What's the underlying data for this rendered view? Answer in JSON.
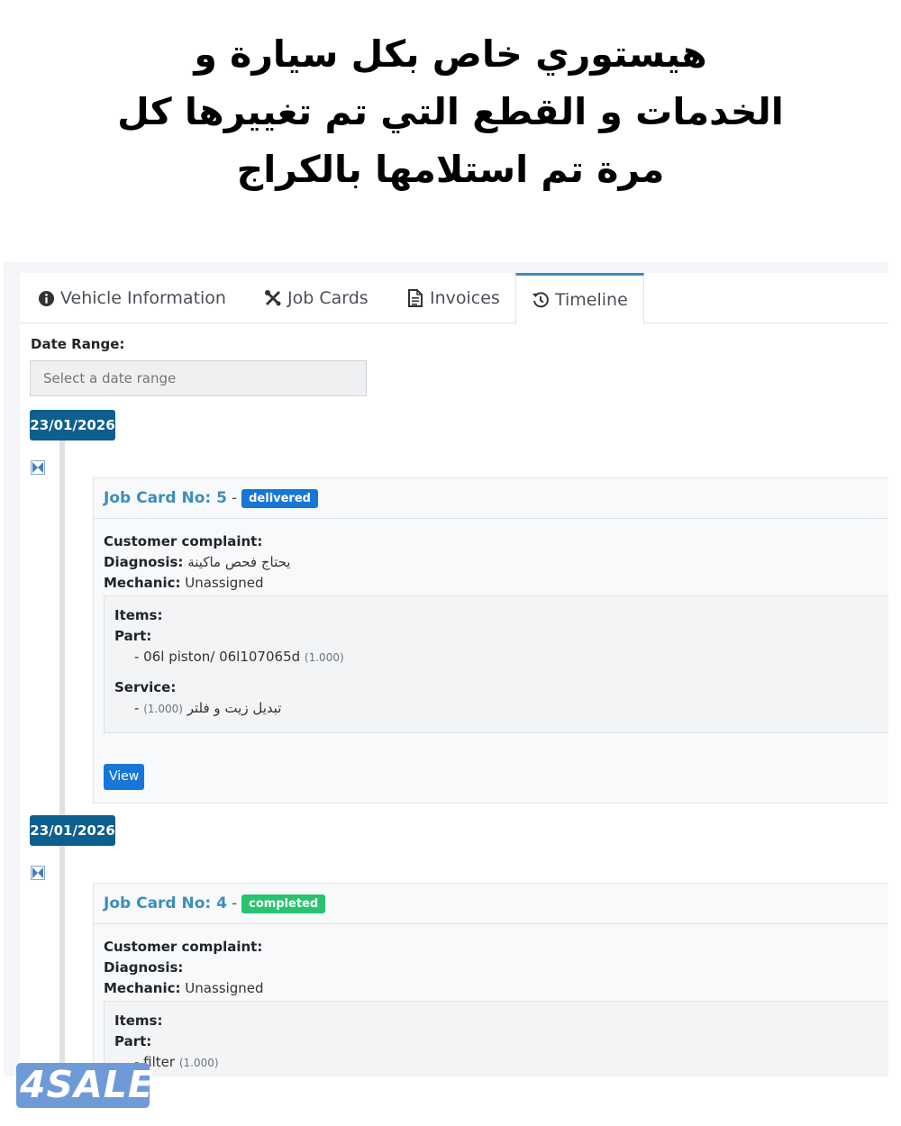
{
  "headline": {
    "line1": "هيستوري خاص بكل سيارة و",
    "line2": "الخدمات و القطع التي تم تغييرها كل",
    "line3": "مرة تم استلامها بالكراج"
  },
  "tabs": [
    {
      "label": "Vehicle Information",
      "icon": "info-circle-icon"
    },
    {
      "label": "Job Cards",
      "icon": "tools-icon"
    },
    {
      "label": "Invoices",
      "icon": "document-icon"
    },
    {
      "label": "Timeline",
      "icon": "history-icon",
      "active": true
    }
  ],
  "date_range": {
    "label": "Date Range:",
    "placeholder": "Select a date range"
  },
  "entries": [
    {
      "date": "23/01/2026",
      "title": "Job Card No: 5",
      "status": "delivered",
      "status_color": "#1777d6",
      "complaint_label": "Customer complaint:",
      "diagnosis_label": "Diagnosis:",
      "diagnosis_value": "يحتاج فحص ماكينة",
      "mechanic_label": "Mechanic:",
      "mechanic_value": "Unassigned",
      "items_label": "Items:",
      "part_label": "Part:",
      "part_item": "- 06l piston/ 06l107065d",
      "part_qty": "(1.000)",
      "service_label": "Service:",
      "service_prefix": "-",
      "service_qty": "(1.000)",
      "service_item": "تبديل زيت و فلتر",
      "view_label": "View"
    },
    {
      "date": "23/01/2026",
      "title": "Job Card No: 4",
      "status": "completed",
      "status_color": "#29c26f",
      "complaint_label": "Customer complaint:",
      "diagnosis_label": "Diagnosis:",
      "mechanic_label": "Mechanic:",
      "mechanic_value": "Unassigned",
      "items_label": "Items:",
      "part_label": "Part:",
      "part_item": "- filter",
      "part_qty": "(1.000)"
    }
  ],
  "watermark": "4SALE"
}
